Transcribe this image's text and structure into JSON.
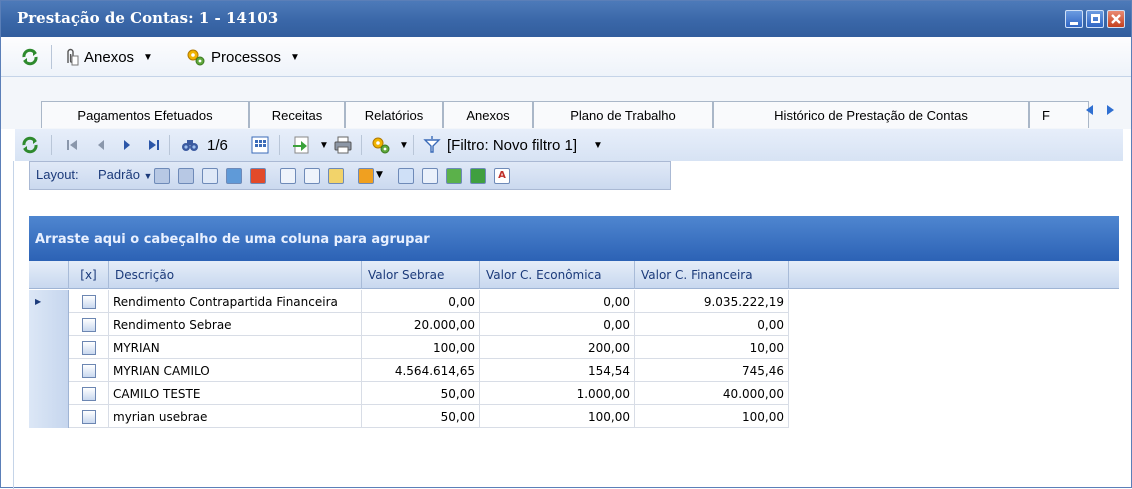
{
  "window": {
    "title": "Prestação de Contas: 1 - 14103",
    "accent": "#3a67a8"
  },
  "main_toolbar": {
    "anexos": "Anexos",
    "processos": "Processos"
  },
  "tabs": [
    {
      "label": "Pagamentos Efetuados"
    },
    {
      "label": "Receitas"
    },
    {
      "label": "Relatórios"
    },
    {
      "label": "Anexos"
    },
    {
      "label": "Plano de Trabalho"
    },
    {
      "label": "Histórico de Prestação de Contas"
    },
    {
      "label": "F"
    }
  ],
  "grid_toolbar": {
    "position": "1/6",
    "filter": "[Filtro: Novo filtro 1]"
  },
  "layout_toolbar": {
    "label": "Layout:",
    "layout_value": "Padrão"
  },
  "grid": {
    "group_hint": "Arraste aqui o cabeçalho de uma coluna para agrupar",
    "columns": [
      "[x]",
      "Descrição",
      "Valor Sebrae",
      "Valor C. Econômica",
      "Valor C. Financeira"
    ],
    "rows": [
      {
        "descricao": "Rendimento Contrapartida Financeira",
        "sebrae": "0,00",
        "economica": "0,00",
        "financeira": "9.035.222,19",
        "current": true
      },
      {
        "descricao": "Rendimento Sebrae",
        "sebrae": "20.000,00",
        "economica": "0,00",
        "financeira": "0,00"
      },
      {
        "descricao": "MYRIAN",
        "sebrae": "100,00",
        "economica": "200,00",
        "financeira": "10,00"
      },
      {
        "descricao": "MYRIAN CAMILO",
        "sebrae": "4.564.614,65",
        "economica": "154,54",
        "financeira": "745,46"
      },
      {
        "descricao": "CAMILO TESTE",
        "sebrae": "50,00",
        "economica": "1.000,00",
        "financeira": "40.000,00"
      },
      {
        "descricao": "myrian usebrae",
        "sebrae": "50,00",
        "economica": "100,00",
        "financeira": "100,00"
      }
    ]
  }
}
